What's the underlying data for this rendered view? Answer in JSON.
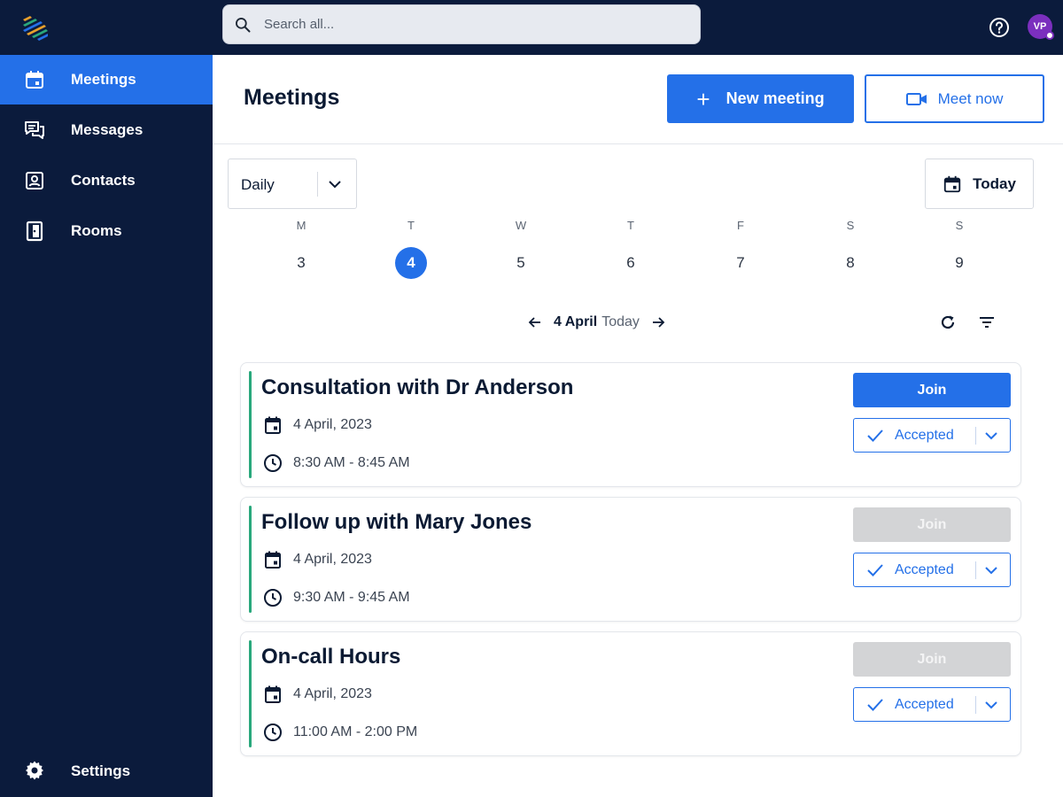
{
  "search": {
    "placeholder": "Search all..."
  },
  "user": {
    "initials": "VP"
  },
  "sidebar": {
    "items": [
      {
        "label": "Meetings",
        "icon": "calendar-icon",
        "active": true
      },
      {
        "label": "Messages",
        "icon": "chat-icon",
        "active": false
      },
      {
        "label": "Contacts",
        "icon": "contact-card-icon",
        "active": false
      },
      {
        "label": "Rooms",
        "icon": "door-icon",
        "active": false
      }
    ],
    "settings_label": "Settings"
  },
  "page": {
    "title": "Meetings",
    "new_meeting_label": "New meeting",
    "meet_now_label": "Meet now",
    "view_value": "Daily",
    "today_button_label": "Today"
  },
  "week": {
    "days": [
      {
        "name": "M",
        "date": "3"
      },
      {
        "name": "T",
        "date": "4"
      },
      {
        "name": "W",
        "date": "5"
      },
      {
        "name": "T",
        "date": "6"
      },
      {
        "name": "F",
        "date": "7"
      },
      {
        "name": "S",
        "date": "8"
      },
      {
        "name": "S",
        "date": "9"
      }
    ],
    "selected_date": "4"
  },
  "date_nav": {
    "date": "4 April",
    "suffix": "Today"
  },
  "meetings": [
    {
      "title": "Consultation with Dr Anderson",
      "date": "4 April, 2023",
      "time": "8:30 AM - 8:45 AM",
      "join_label": "Join",
      "join_enabled": true,
      "status": "Accepted"
    },
    {
      "title": "Follow up with Mary Jones",
      "date": "4 April, 2023",
      "time": "9:30 AM - 9:45 AM",
      "join_label": "Join",
      "join_enabled": false,
      "status": "Accepted"
    },
    {
      "title": "On-call Hours",
      "date": "4 April, 2023",
      "time": "11:00 AM - 2:00 PM",
      "join_label": "Join",
      "join_enabled": false,
      "status": "Accepted"
    }
  ],
  "colors": {
    "primary": "#2470e8",
    "nav_bg": "#0b1b3c",
    "accent_bar": "#29a87c",
    "disabled": "#d3d4d6"
  }
}
